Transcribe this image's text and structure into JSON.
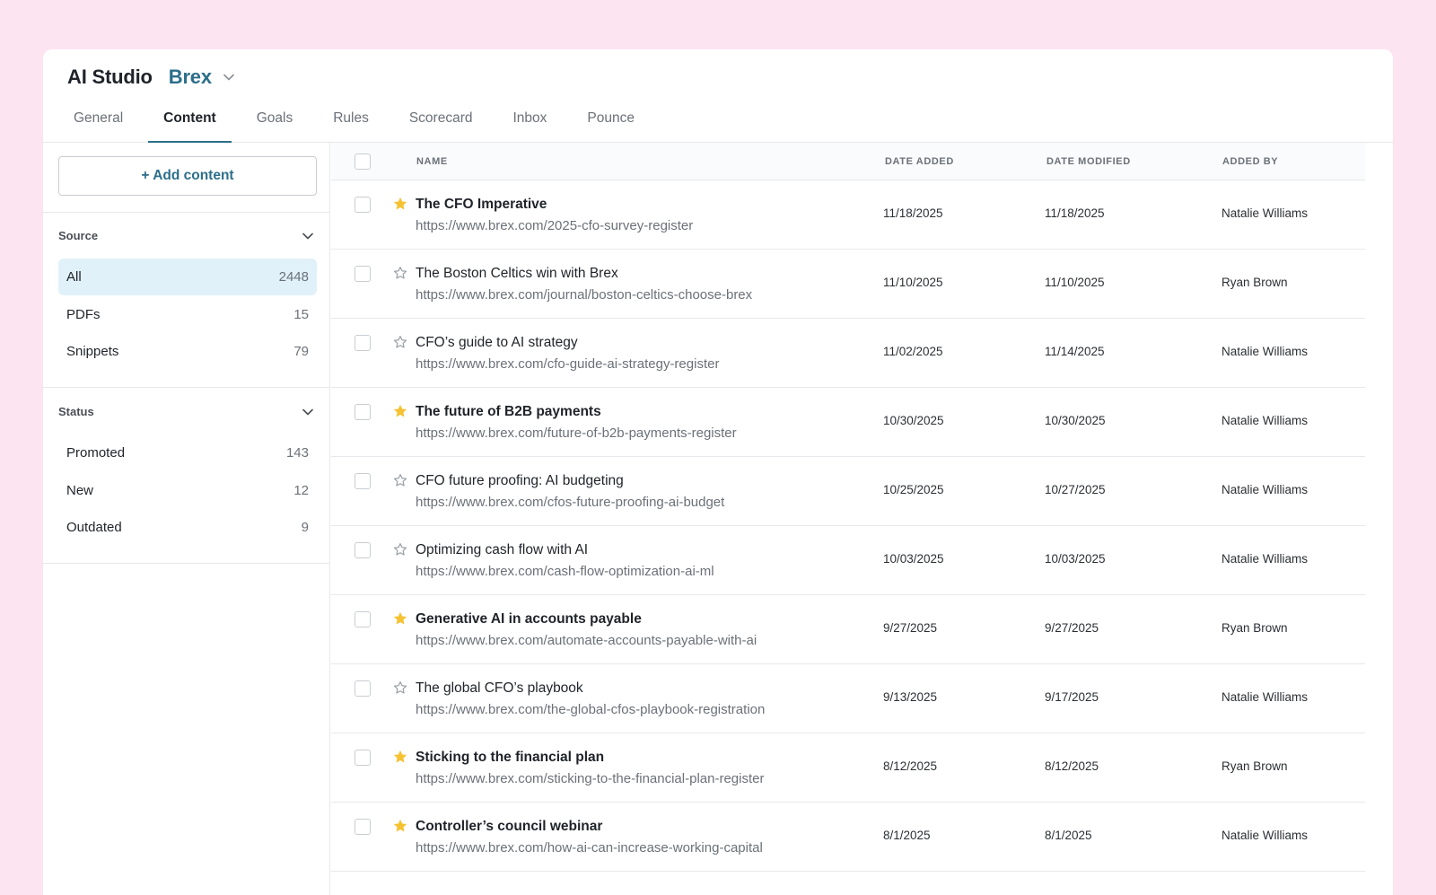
{
  "header": {
    "app_title": "AI Studio",
    "workspace": "Brex",
    "tabs": [
      "General",
      "Content",
      "Goals",
      "Rules",
      "Scorecard",
      "Inbox",
      "Pounce"
    ],
    "active_tab": "Content"
  },
  "sidebar": {
    "add_button": "+ Add content",
    "source": {
      "heading": "Source",
      "items": [
        {
          "label": "All",
          "count": "2448",
          "selected": true
        },
        {
          "label": "PDFs",
          "count": "15"
        },
        {
          "label": "Snippets",
          "count": "79"
        }
      ]
    },
    "status": {
      "heading": "Status",
      "items": [
        {
          "label": "Promoted",
          "count": "143"
        },
        {
          "label": "New",
          "count": "12"
        },
        {
          "label": "Outdated",
          "count": "9"
        }
      ]
    }
  },
  "table": {
    "columns": [
      "NAME",
      "DATE ADDED",
      "DATE MODIFIED",
      "ADDED BY"
    ],
    "rows": [
      {
        "title": "The CFO Imperative",
        "url": "https://www.brex.com/2025-cfo-survey-register",
        "date_added": "11/18/2025",
        "date_modified": "11/18/2025",
        "added_by": "Natalie Williams",
        "starred": true
      },
      {
        "title": "The Boston Celtics win with Brex",
        "url": "https://www.brex.com/journal/boston-celtics-choose-brex",
        "date_added": "11/10/2025",
        "date_modified": "11/10/2025",
        "added_by": "Ryan Brown",
        "starred": false
      },
      {
        "title": "CFO’s guide to AI strategy",
        "url": "https://www.brex.com/cfo-guide-ai-strategy-register",
        "date_added": "11/02/2025",
        "date_modified": "11/14/2025",
        "added_by": "Natalie Williams",
        "starred": false
      },
      {
        "title": "The future of B2B payments",
        "url": "https://www.brex.com/future-of-b2b-payments-register",
        "date_added": "10/30/2025",
        "date_modified": "10/30/2025",
        "added_by": "Natalie Williams",
        "starred": true
      },
      {
        "title": "CFO future proofing: AI budgeting",
        "url": "https://www.brex.com/cfos-future-proofing-ai-budget",
        "date_added": "10/25/2025",
        "date_modified": "10/27/2025",
        "added_by": "Natalie Williams",
        "starred": false
      },
      {
        "title": "Optimizing cash flow with AI",
        "url": "https://www.brex.com/cash-flow-optimization-ai-ml",
        "date_added": "10/03/2025",
        "date_modified": "10/03/2025",
        "added_by": "Natalie Williams",
        "starred": false
      },
      {
        "title": "Generative AI in accounts payable",
        "url": "https://www.brex.com/automate-accounts-payable-with-ai",
        "date_added": "9/27/2025",
        "date_modified": "9/27/2025",
        "added_by": "Ryan Brown",
        "starred": true
      },
      {
        "title": "The global CFO’s playbook",
        "url": "https://www.brex.com/the-global-cfos-playbook-registration",
        "date_added": "9/13/2025",
        "date_modified": "9/17/2025",
        "added_by": "Natalie Williams",
        "starred": false
      },
      {
        "title": "Sticking to the financial plan",
        "url": "https://www.brex.com/sticking-to-the-financial-plan-register",
        "date_added": "8/12/2025",
        "date_modified": "8/12/2025",
        "added_by": "Ryan Brown",
        "starred": true
      },
      {
        "title": "Controller’s council webinar",
        "url": "https://www.brex.com/how-ai-can-increase-working-capital",
        "date_added": "8/1/2025",
        "date_modified": "8/1/2025",
        "added_by": "Natalie Williams",
        "starred": true
      }
    ]
  },
  "colors": {
    "accent": "#2c6e8a",
    "star_filled": "#f5c232",
    "star_outline": "#9aa0a6",
    "selected_bg": "#e1f1f9",
    "page_bg": "#fde4f1"
  },
  "icons": {
    "workspace_chevron": "chevron-down-icon",
    "section_chevron": "chevron-down-icon",
    "favorite": "star-icon"
  }
}
